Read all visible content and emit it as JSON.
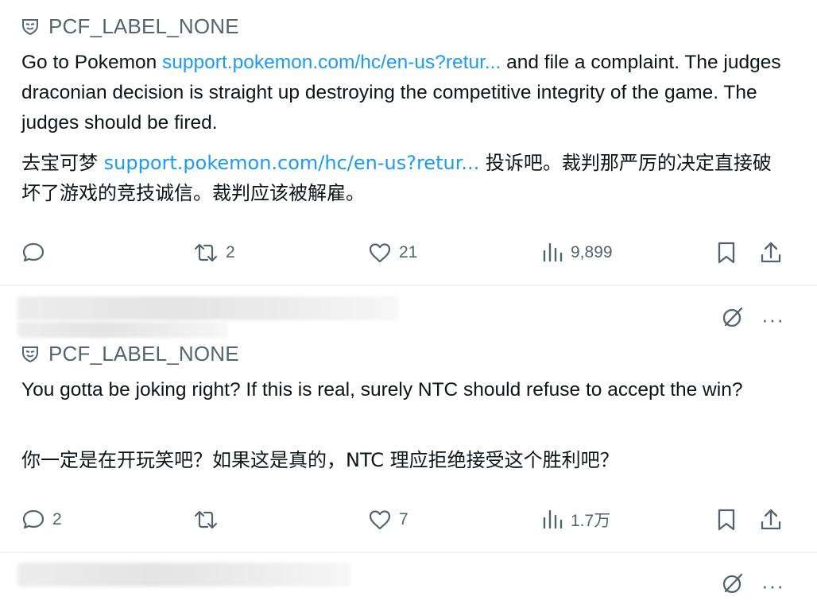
{
  "posts": [
    {
      "label": "PCF_LABEL_NONE",
      "text_en": {
        "before_link": "Go to Pokemon ",
        "link": "support.pokemon.com/hc/en-us?retur...",
        "after_link": " and file a complaint. The judges draconian decision is straight up destroying the competitive integrity of the game. The judges should be fired."
      },
      "text_zh": {
        "before_link": "去宝可梦 ",
        "link": "support.pokemon.com/hc/en-us?retur...",
        "after_link": " 投诉吧。裁判那严厉的决定直接破坏了游戏的竞技诚信。裁判应该被解雇。"
      },
      "stats": {
        "replies": "",
        "reposts": "2",
        "likes": "21",
        "views": "9,899"
      }
    },
    {
      "label": "PCF_LABEL_NONE",
      "text_en": "You gotta be joking right? If this is real, surely NTC should refuse to accept the win?",
      "text_zh": "你一定是在开玩笑吧？如果这是真的，NTC 理应拒绝接受这个胜利吧？",
      "stats": {
        "replies": "2",
        "reposts": "",
        "likes": "7",
        "views": "1.7万"
      }
    }
  ],
  "more_label": "···",
  "icons": {
    "label_icon": "shield-mask-icon",
    "reply": "reply-icon",
    "repost": "repost-icon",
    "like": "heart-icon",
    "views": "views-chart-icon",
    "bookmark": "bookmark-icon",
    "share": "share-icon",
    "grok": "grok-icon",
    "more": "more-icon"
  },
  "colors": {
    "text": "#0f1419",
    "secondary": "#536471",
    "link": "#1d9bf0",
    "divider": "#eff3f4"
  }
}
